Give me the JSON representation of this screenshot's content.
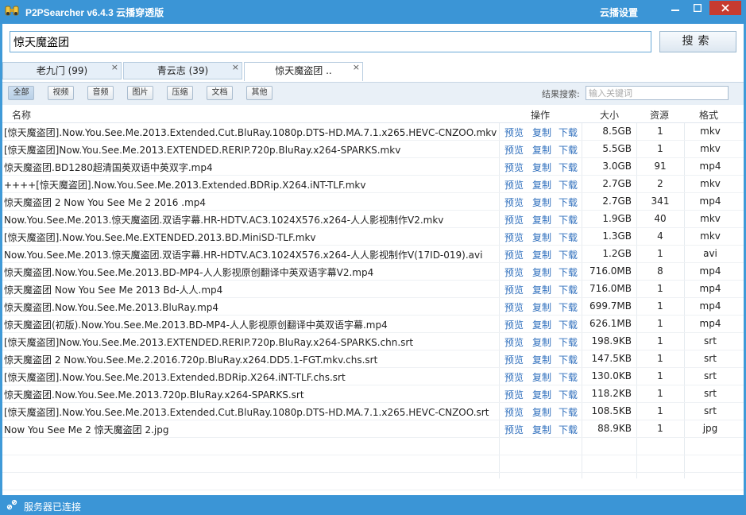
{
  "window": {
    "title": "P2PSearcher v6.4.3 云播穿透版",
    "cloud_settings": "云播设置"
  },
  "search": {
    "value": "惊天魔盗团",
    "button": "搜索"
  },
  "tabs": [
    {
      "label": "老九门 (99)",
      "close": "×"
    },
    {
      "label": "青云志 (39)",
      "close": "×"
    },
    {
      "label": "惊天魔盗团 ..",
      "close": "×"
    }
  ],
  "filters": {
    "buttons": [
      "全部",
      "视频",
      "音频",
      "图片",
      "压缩",
      "文档",
      "其他"
    ],
    "result_search_label": "结果搜索:",
    "keyword_placeholder": "输入关键词"
  },
  "table": {
    "headers": {
      "name": "名称",
      "ops": "操作",
      "size": "大小",
      "source": "资源",
      "format": "格式"
    },
    "actions": [
      "预览",
      "复制",
      "下载"
    ],
    "rows": [
      {
        "name": "[惊天魔盗团].Now.You.See.Me.2013.Extended.Cut.BluRay.1080p.DTS-HD.MA.7.1.x265.HEVC-CNZOO.mkv",
        "size": "8.5GB",
        "source": "1",
        "format": "mkv"
      },
      {
        "name": "[惊天魔盗团]Now.You.See.Me.2013.EXTENDED.RERIP.720p.BluRay.x264-SPARKS.mkv",
        "size": "5.5GB",
        "source": "1",
        "format": "mkv"
      },
      {
        "name": "惊天魔盗团.BD1280超清国英双语中英双字.mp4",
        "size": "3.0GB",
        "source": "91",
        "format": "mp4"
      },
      {
        "name": "++++[惊天魔盗团].Now.You.See.Me.2013.Extended.BDRip.X264.iNT-TLF.mkv",
        "size": "2.7GB",
        "source": "2",
        "format": "mkv"
      },
      {
        "name": "惊天魔盗团 2 Now You See Me 2  2016 .mp4",
        "size": "2.7GB",
        "source": "341",
        "format": "mp4"
      },
      {
        "name": "Now.You.See.Me.2013.惊天魔盗团.双语字幕.HR-HDTV.AC3.1024X576.x264-人人影视制作V2.mkv",
        "size": "1.9GB",
        "source": "40",
        "format": "mkv"
      },
      {
        "name": "[惊天魔盗团].Now.You.See.Me.EXTENDED.2013.BD.MiniSD-TLF.mkv",
        "size": "1.3GB",
        "source": "4",
        "format": "mkv"
      },
      {
        "name": "Now.You.See.Me.2013.惊天魔盗团.双语字幕.HR-HDTV.AC3.1024X576.x264-人人影视制作V(17ID-019).avi",
        "size": "1.2GB",
        "source": "1",
        "format": "avi"
      },
      {
        "name": "惊天魔盗团.Now.You.See.Me.2013.BD-MP4-人人影视原创翻译中英双语字幕V2.mp4",
        "size": "716.0MB",
        "source": "8",
        "format": "mp4"
      },
      {
        "name": "惊天魔盗团 Now You See Me 2013 Bd-人人.mp4",
        "size": "716.0MB",
        "source": "1",
        "format": "mp4"
      },
      {
        "name": "惊天魔盗团.Now.You.See.Me.2013.BluRay.mp4",
        "size": "699.7MB",
        "source": "1",
        "format": "mp4"
      },
      {
        "name": "惊天魔盗团(初版).Now.You.See.Me.2013.BD-MP4-人人影视原创翻译中英双语字幕.mp4",
        "size": "626.1MB",
        "source": "1",
        "format": "mp4"
      },
      {
        "name": "[惊天魔盗团]Now.You.See.Me.2013.EXTENDED.RERIP.720p.BluRay.x264-SPARKS.chn.srt",
        "size": "198.9KB",
        "source": "1",
        "format": "srt"
      },
      {
        "name": "惊天魔盗团 2 Now.You.See.Me.2.2016.720p.BluRay.x264.DD5.1-FGT.mkv.chs.srt",
        "size": "147.5KB",
        "source": "1",
        "format": "srt"
      },
      {
        "name": "[惊天魔盗团].Now.You.See.Me.2013.Extended.BDRip.X264.iNT-TLF.chs.srt",
        "size": "130.0KB",
        "source": "1",
        "format": "srt"
      },
      {
        "name": "惊天魔盗团.Now.You.See.Me.2013.720p.BluRay.x264-SPARKS.srt",
        "size": "118.2KB",
        "source": "1",
        "format": "srt"
      },
      {
        "name": "[惊天魔盗团].Now.You.See.Me.2013.Extended.Cut.BluRay.1080p.DTS-HD.MA.7.1.x265.HEVC-CNZOO.srt",
        "size": "108.5KB",
        "source": "1",
        "format": "srt"
      },
      {
        "name": "Now You See Me 2 惊天魔盗团 2.jpg",
        "size": "88.9KB",
        "source": "1",
        "format": "jpg"
      }
    ]
  },
  "status": {
    "text": "服务器已连接"
  },
  "colors": {
    "accent": "#3b95d6",
    "link": "#2f6fbd"
  }
}
